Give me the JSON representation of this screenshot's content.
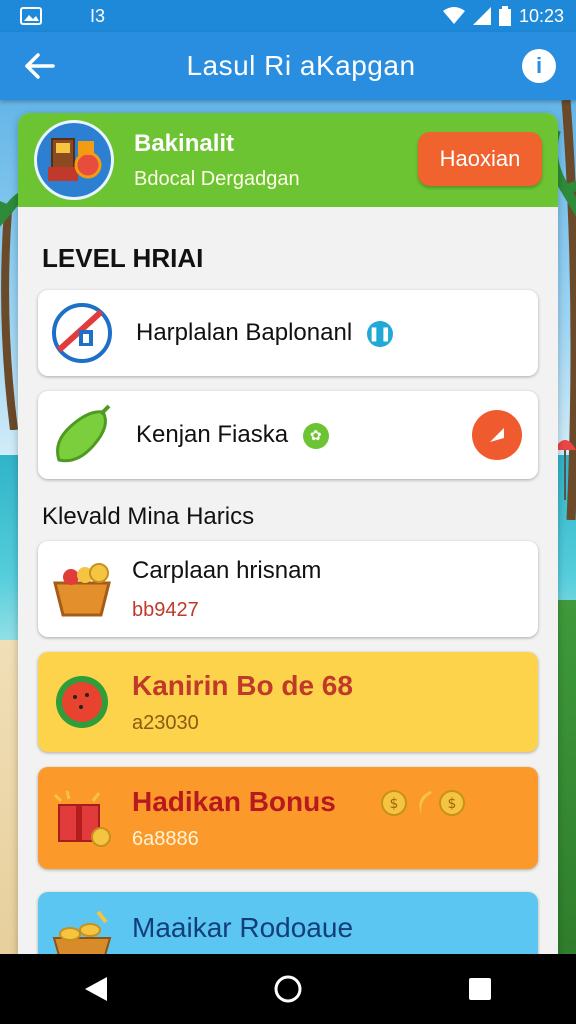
{
  "status_bar": {
    "left_code": "I3",
    "time": "10:23"
  },
  "app_bar": {
    "title": "Lasul Ri aKapgan",
    "info_symbol": "i"
  },
  "header": {
    "title": "Bakinalit",
    "subtitle": "Bdocal Dergadgan",
    "button_label": "Haoxian"
  },
  "section1": {
    "title": "LEVEL HRIAI"
  },
  "items": [
    {
      "label": "Harplalan Baplonanl"
    },
    {
      "label": "Kenjan Fiaska"
    }
  ],
  "section2": {
    "title": "Klevald Mina Harics"
  },
  "reward_items": [
    {
      "title": "Carplaan hrisnam",
      "value": "bb9427",
      "bg": "#ffffff"
    },
    {
      "title": "Kanirin Bo de 68",
      "value": "a23030",
      "bg": "#fcd34a"
    },
    {
      "title": "Hadikan Bonus",
      "value": "6a8886",
      "bg": "#fb9a2b"
    },
    {
      "title": "Maaikar Rodoaue",
      "value": "",
      "bg": "#5bc6f2"
    }
  ],
  "colors": {
    "statusbar": "#1e88d9",
    "appbar": "#2a8ee0",
    "header": "#6cc432",
    "accent": "#f0622e"
  }
}
